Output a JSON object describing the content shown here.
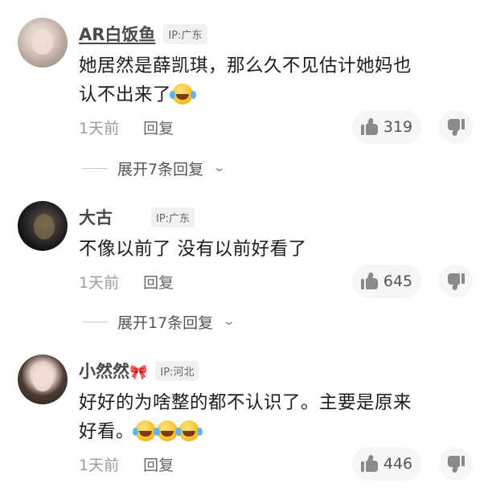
{
  "comments": [
    {
      "username": "AR白饭鱼",
      "ip": "IP:广东",
      "text_line1": "她居然是薛凯琪，那么久不见估计她妈也",
      "text_line2": "认不出来了",
      "emoji_count": 1,
      "time": "1天前",
      "reply_label": "回复",
      "likes": "319",
      "expand_label": "展开7条回复"
    },
    {
      "username": "大古",
      "ip": "IP:广东",
      "text_line1": "不像以前了 没有以前好看了",
      "time": "1天前",
      "reply_label": "回复",
      "likes": "645",
      "expand_label": "展开17条回复"
    },
    {
      "username": "小然然",
      "ip": "IP:河北",
      "bow": "🎀",
      "text_line1": "好好的为啥整的都不认识了。主要是原来",
      "text_line2": "好看。",
      "emoji_count": 3,
      "time": "1天前",
      "reply_label": "回复",
      "likes": "446"
    }
  ],
  "icons": {
    "like": "thumbs-up-icon",
    "dislike": "thumbs-down-icon",
    "expand": "chevron-down-icon",
    "emoji": "laughing-tears-emoji"
  }
}
